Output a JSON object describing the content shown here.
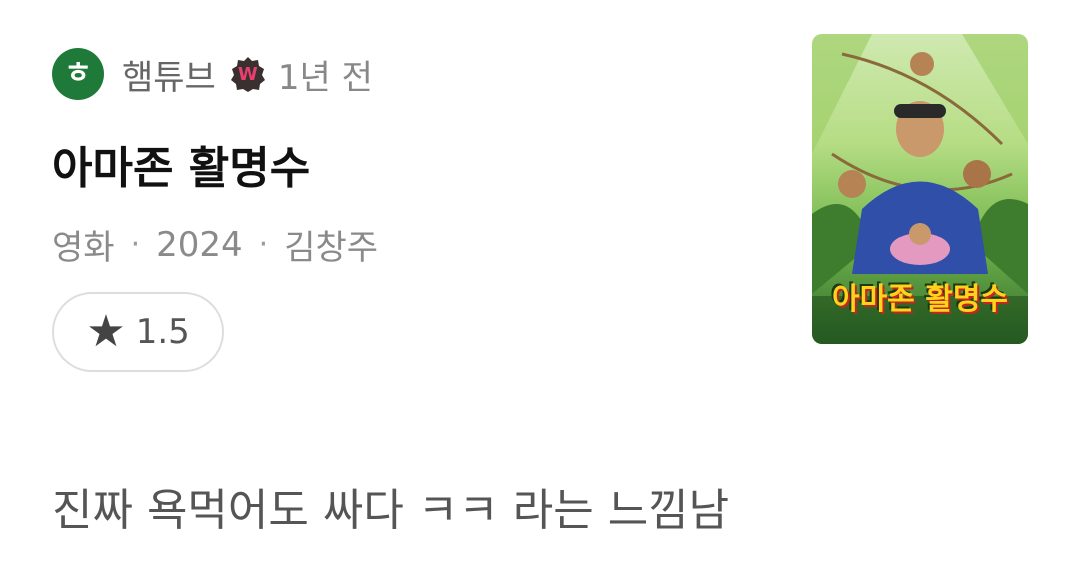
{
  "author": {
    "avatar_char": "ㅎ",
    "name": "햄튜브",
    "badge_letter": "W",
    "time_ago": "1년 전"
  },
  "movie": {
    "title": "아마존 활명수",
    "category": "영화",
    "year": "2024",
    "director": "김창주",
    "rating": "1.5",
    "poster_title": "아마존 활명수"
  },
  "comment": "진짜 욕먹어도 싸다 ㅋㅋ 라는 느낌남",
  "colors": {
    "avatar_bg": "#1f7a3a",
    "badge_bg": "#3a3030",
    "badge_text": "#e83f6f"
  },
  "icons": {
    "rating": "star-icon",
    "badge": "writer-badge-icon"
  }
}
